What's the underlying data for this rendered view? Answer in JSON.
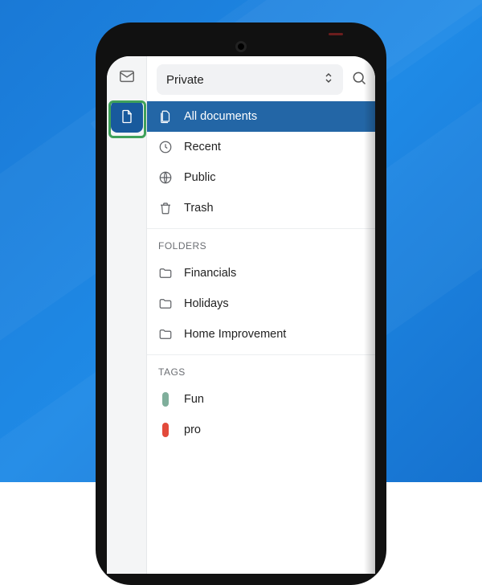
{
  "selector": {
    "label": "Private"
  },
  "nav": [
    {
      "icon": "documents-icon",
      "label": "All documents",
      "active": true
    },
    {
      "icon": "clock-icon",
      "label": "Recent"
    },
    {
      "icon": "globe-icon",
      "label": "Public"
    },
    {
      "icon": "trash-icon",
      "label": "Trash"
    }
  ],
  "folders_header": "FOLDERS",
  "folders": [
    {
      "label": "Financials"
    },
    {
      "label": "Holidays"
    },
    {
      "label": "Home Improvement"
    }
  ],
  "tags_header": "TAGS",
  "tags": [
    {
      "label": "Fun",
      "color": "#7fae9b"
    },
    {
      "label": "pro",
      "color": "#e24a3b"
    }
  ]
}
